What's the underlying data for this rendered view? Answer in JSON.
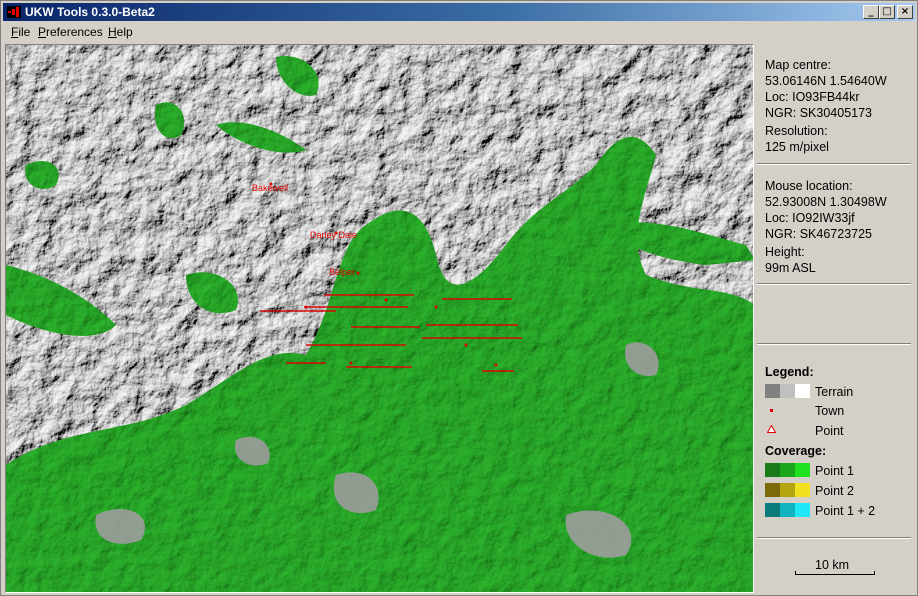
{
  "window": {
    "title": "UKW Tools 0.3.0-Beta2"
  },
  "menu": [
    {
      "label": "File",
      "accel": "F",
      "rest": "ile"
    },
    {
      "label": "Preferences",
      "accel": "P",
      "rest": "references"
    },
    {
      "label": "Help",
      "accel": "H",
      "rest": "elp"
    }
  ],
  "info": {
    "map_centre_title": "Map centre:",
    "map_centre_coords": "53.06146N 1.54640W",
    "map_centre_loc": "Loc: IO93FB44kr",
    "map_centre_ngr": "NGR: SK30405173",
    "resolution_title": "Resolution:",
    "resolution_value": "125 m/pixel",
    "mouse_title": "Mouse location:",
    "mouse_coords": "52.93008N 1.30498W",
    "mouse_loc": "Loc: IO92IW33jf",
    "mouse_ngr": "NGR: SK46723725",
    "height_title": "Height:",
    "height_value": "99m ASL"
  },
  "legend": {
    "title": "Legend:",
    "terrain": "Terrain",
    "town": "Town",
    "point": "Point",
    "coverage_title": "Coverage:",
    "point1": "Point 1",
    "point2": "Point 2",
    "point12": "Point 1 + 2"
  },
  "scale": {
    "label": "10 km"
  },
  "colors": {
    "coverage": "#1a9a1a",
    "town": "#e00000",
    "terrain_light": "#ffffff",
    "terrain_mid": "#c0c0c0",
    "terrain_dark": "#808080"
  },
  "map": {
    "towns": [
      "Bakewell",
      "Darley Dale",
      "Belper"
    ]
  }
}
